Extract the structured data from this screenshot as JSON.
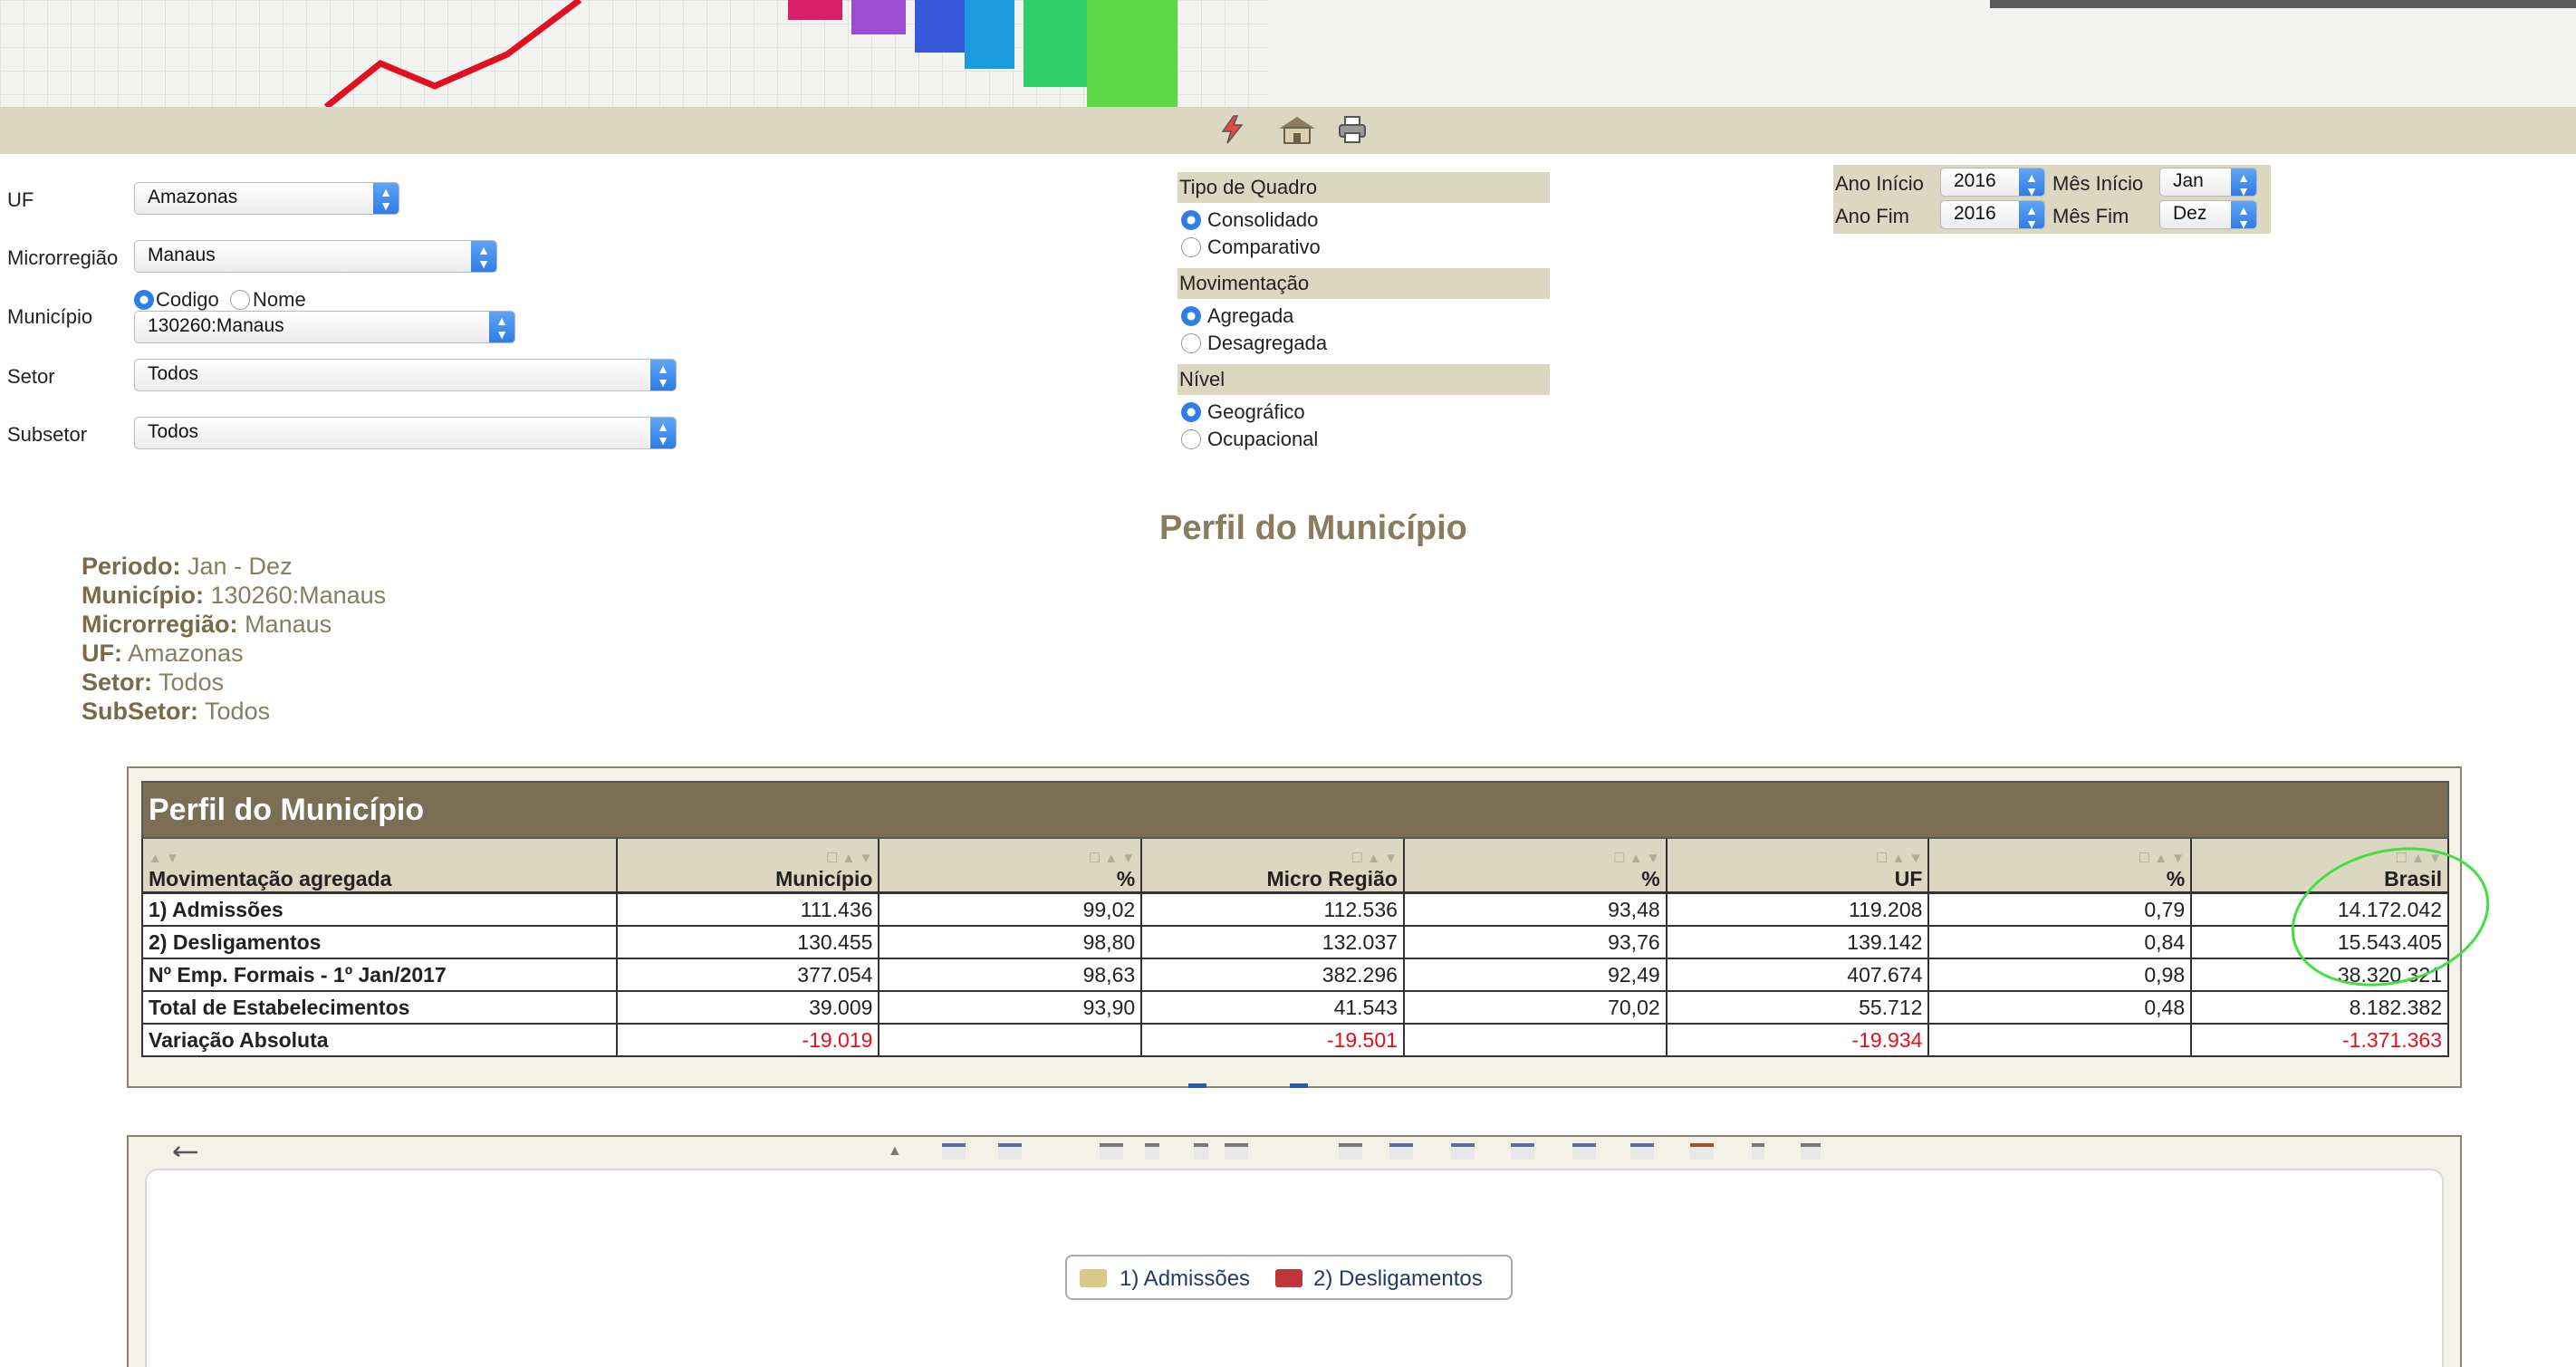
{
  "filters": {
    "uf": {
      "label": "UF",
      "value": "Amazonas"
    },
    "microrregiao": {
      "label": "Microrregião",
      "value": "Manaus"
    },
    "municipio": {
      "label": "Município",
      "value": "130260:Manaus",
      "radio_codigo": "Codigo",
      "radio_nome": "Nome",
      "selected": "Codigo"
    },
    "setor": {
      "label": "Setor",
      "value": "Todos"
    },
    "subsetor": {
      "label": "Subsetor",
      "value": "Todos"
    }
  },
  "options": {
    "tipo_quadro": {
      "label": "Tipo de Quadro",
      "options": [
        "Consolidado",
        "Comparativo"
      ],
      "selected": "Consolidado"
    },
    "movimentacao": {
      "label": "Movimentação",
      "options": [
        "Agregada",
        "Desagregada"
      ],
      "selected": "Agregada"
    },
    "nivel": {
      "label": "Nível",
      "options": [
        "Geográfico",
        "Ocupacional"
      ],
      "selected": "Geográfico"
    }
  },
  "period": {
    "ano_inicio_label": "Ano Início",
    "ano_inicio": "2016",
    "mes_inicio_label": "Mês Início",
    "mes_inicio": "Jan",
    "ano_fim_label": "Ano Fim",
    "ano_fim": "2016",
    "mes_fim_label": "Mês Fim",
    "mes_fim": "Dez"
  },
  "summary": {
    "title": "Perfil do Município",
    "periodo_label": "Periodo:",
    "periodo": "Jan - Dez",
    "municipio_label": "Município:",
    "municipio": "130260:Manaus",
    "micro_label": "Microrregião:",
    "micro": "Manaus",
    "uf_label": "UF:",
    "uf": "Amazonas",
    "setor_label": "Setor:",
    "setor": "Todos",
    "subsetor_label": "SubSetor:",
    "subsetor": "Todos"
  },
  "table": {
    "title": "Perfil do Município",
    "sort_glyphs": "☐ ▲ ▼",
    "columns": [
      "Movimentação agregada",
      "Município",
      "%",
      "Micro Região",
      "%",
      "UF",
      "%",
      "Brasil"
    ],
    "rows": [
      [
        "1) Admissões",
        "111.436",
        "99,02",
        "112.536",
        "93,48",
        "119.208",
        "0,79",
        "14.172.042"
      ],
      [
        "2) Desligamentos",
        "130.455",
        "98,80",
        "132.037",
        "93,76",
        "139.142",
        "0,84",
        "15.543.405"
      ],
      [
        "Nº Emp. Formais - 1º Jan/2017",
        "377.054",
        "98,63",
        "382.296",
        "92,49",
        "407.674",
        "0,98",
        "38.320.321"
      ],
      [
        "Total de Estabelecimentos",
        "39.009",
        "93,90",
        "41.543",
        "70,02",
        "55.712",
        "0,48",
        "8.182.382"
      ],
      [
        "Variação Absoluta",
        "-19.019",
        "",
        "-19.501",
        "",
        "-19.934",
        "",
        "-1.371.363"
      ]
    ]
  },
  "chart": {
    "legend": [
      {
        "label": "1) Admissões",
        "color": "#d8c98a"
      },
      {
        "label": "2) Desligamentos",
        "color": "#c0353a"
      }
    ]
  },
  "icons": [
    "lightning-icon",
    "home-icon",
    "print-icon"
  ]
}
